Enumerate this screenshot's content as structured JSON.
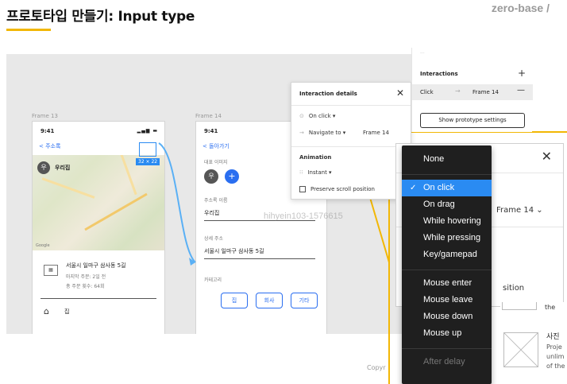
{
  "slide": {
    "title": "프로토타입 만들기: Input type",
    "brand": "zero-base /",
    "watermark": "hihyein103-1576615",
    "copyright": "Copyr",
    "accent": "#f2b705"
  },
  "frames": {
    "frame1": {
      "label": "Frame 13",
      "time": "9:41",
      "back": "< 주소록",
      "pin": "우",
      "map_label": "우리집",
      "google": "Google",
      "selection_badge": "32 × 22",
      "address": "서울시 일마구 삼사동 5길",
      "sub1": "마지막 주문: 2일 전",
      "sub2": "총 주문 횟수: 64회",
      "home_label": "집",
      "icons": [
        "building-icon",
        "home-icon"
      ]
    },
    "frame2": {
      "label": "Frame 14",
      "time": "9:41",
      "back": "< 돌아가기",
      "rep_image_label": "대표 이미지",
      "circle": "우",
      "name_label": "주소록 이름",
      "name_value": "우리집",
      "addr_label": "상세 주소",
      "addr_value": "서울시 일마구 삼사동 5길",
      "category_label": "카테고리",
      "chips": [
        "집",
        "회사",
        "기타"
      ]
    }
  },
  "interaction_panel": {
    "title": "Interaction details",
    "trigger": "On click",
    "action": "Navigate to",
    "destination": "Frame 14",
    "animation_title": "Animation",
    "animation_value": "Instant",
    "checkbox_label": "Preserve scroll position"
  },
  "prototype_panel": {
    "partial_header": "...",
    "heading": "Interactions",
    "row_trigger": "Click",
    "row_destination": "Frame 14",
    "button": "Show prototype settings"
  },
  "zoom_panel": {
    "frame": "Frame 14",
    "partial_text": "sition"
  },
  "dropdown": {
    "items": [
      {
        "label": "None",
        "selected": false,
        "disabled": false
      },
      {
        "label": "On click",
        "selected": true,
        "disabled": false
      },
      {
        "label": "On drag",
        "selected": false,
        "disabled": false
      },
      {
        "label": "While hovering",
        "selected": false,
        "disabled": false
      },
      {
        "label": "While pressing",
        "selected": false,
        "disabled": false
      },
      {
        "label": "Key/gamepad",
        "selected": false,
        "disabled": false
      },
      {
        "label": "Mouse enter",
        "selected": false,
        "disabled": false
      },
      {
        "label": "Mouse leave",
        "selected": false,
        "disabled": false
      },
      {
        "label": "Mouse down",
        "selected": false,
        "disabled": false
      },
      {
        "label": "Mouse up",
        "selected": false,
        "disabled": false
      },
      {
        "label": "After delay",
        "selected": false,
        "disabled": true
      }
    ]
  },
  "right_bottom": {
    "partial_top": "the",
    "title": "사진",
    "lines": [
      "Proje",
      "unlim",
      "of the"
    ]
  }
}
